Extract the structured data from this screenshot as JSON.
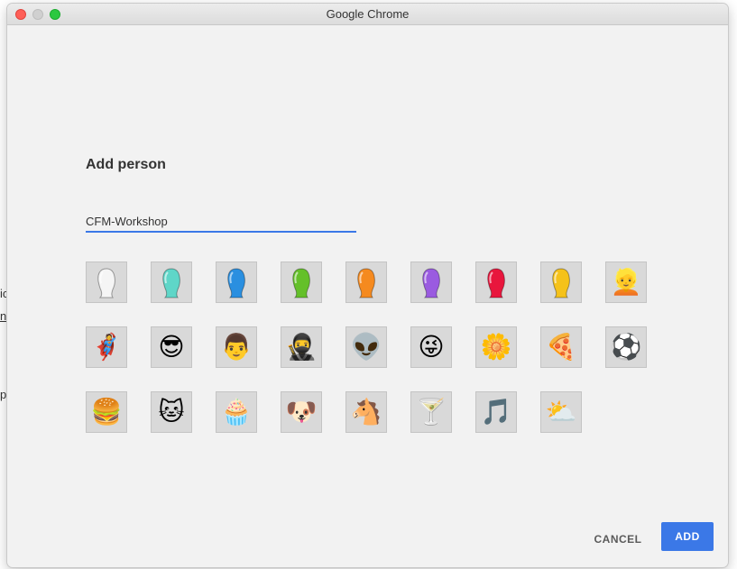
{
  "background": {
    "fragments": [
      "ic",
      "no",
      "p"
    ]
  },
  "window": {
    "title": "Google Chrome"
  },
  "dialog": {
    "heading": "Add person",
    "name_value": "CFM-Workshop",
    "cancel_label": "CANCEL",
    "add_label": "ADD"
  },
  "avatars": [
    {
      "name": "white-person-icon",
      "kind": "silhouette",
      "color": "#f5f5f5"
    },
    {
      "name": "teal-person-icon",
      "kind": "silhouette",
      "color": "#5fd6c8"
    },
    {
      "name": "blue-person-icon",
      "kind": "silhouette",
      "color": "#2a8fe0"
    },
    {
      "name": "green-person-icon",
      "kind": "silhouette",
      "color": "#64c02a"
    },
    {
      "name": "orange-person-icon",
      "kind": "silhouette",
      "color": "#f58a1f"
    },
    {
      "name": "purple-person-icon",
      "kind": "silhouette",
      "color": "#9a5be0"
    },
    {
      "name": "red-person-icon",
      "kind": "silhouette",
      "color": "#e8163d"
    },
    {
      "name": "yellow-person-icon",
      "kind": "silhouette",
      "color": "#f5c21a"
    },
    {
      "name": "blonde-woman-icon",
      "kind": "emoji",
      "glyph": "👱"
    },
    {
      "name": "superhero-icon",
      "kind": "emoji",
      "glyph": "🦸"
    },
    {
      "name": "woman-sunglasses-icon",
      "kind": "emoji",
      "glyph": "😎"
    },
    {
      "name": "businessman-icon",
      "kind": "emoji",
      "glyph": "👨"
    },
    {
      "name": "ninja-icon",
      "kind": "emoji",
      "glyph": "🥷"
    },
    {
      "name": "alien-icon",
      "kind": "emoji",
      "glyph": "👽"
    },
    {
      "name": "smiley-icon",
      "kind": "emoji",
      "glyph": "😜"
    },
    {
      "name": "flower-icon",
      "kind": "emoji",
      "glyph": "🌼"
    },
    {
      "name": "pizza-icon",
      "kind": "emoji",
      "glyph": "🍕"
    },
    {
      "name": "soccer-ball-icon",
      "kind": "emoji",
      "glyph": "⚽"
    },
    {
      "name": "burger-icon",
      "kind": "emoji",
      "glyph": "🍔"
    },
    {
      "name": "cat-icon",
      "kind": "emoji",
      "glyph": "🐱"
    },
    {
      "name": "cupcake-icon",
      "kind": "emoji",
      "glyph": "🧁"
    },
    {
      "name": "dog-icon",
      "kind": "emoji",
      "glyph": "🐶"
    },
    {
      "name": "horse-icon",
      "kind": "emoji",
      "glyph": "🐴"
    },
    {
      "name": "cocktail-icon",
      "kind": "emoji",
      "glyph": "🍸"
    },
    {
      "name": "music-note-icon",
      "kind": "emoji",
      "glyph": "🎵"
    },
    {
      "name": "sun-cloud-icon",
      "kind": "emoji",
      "glyph": "⛅"
    }
  ],
  "colors": {
    "accent": "#3b78e7"
  }
}
